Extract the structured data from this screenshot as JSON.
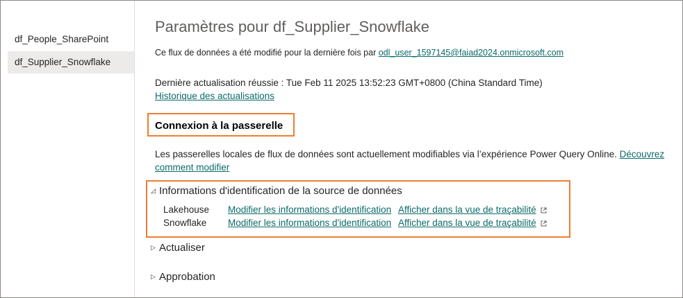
{
  "sidebar": {
    "items": [
      {
        "label": "df_People_SharePoint",
        "selected": false
      },
      {
        "label": "df_Supplier_Snowflake",
        "selected": true
      }
    ]
  },
  "main": {
    "title": "Paramètres pour df_Supplier_Snowflake",
    "modified_prefix": "Ce flux de données a été modifié pour la dernière fois par ",
    "modified_by": "odl_user_1597145@faiad2024.onmicrosoft.com",
    "last_refresh": "Dernière actualisation réussie : Tue Feb 11 2025 13:52:23 GMT+0800 (China Standard Time)",
    "history_link": "Historique des actualisations",
    "gateway": {
      "title": "Connexion à la passerelle",
      "description": "Les passerelles locales de flux de données sont actuellement modifiables via l’expérience Power Query Online. ",
      "learn_link": "Découvrez comment modifier"
    },
    "credentials": {
      "title": "Informations d'identification de la source de données",
      "expanded": true,
      "rows": [
        {
          "name": "Lakehouse",
          "edit": "Modifier les informations d'identification",
          "lineage": "Afficher dans la vue de traçabilité"
        },
        {
          "name": "Snowflake",
          "edit": "Modifier les informations d'identification",
          "lineage": "Afficher dans la vue de traçabilité"
        }
      ]
    },
    "refresh_section": {
      "title": "Actualiser",
      "expanded": false
    },
    "approval_section": {
      "title": "Approbation",
      "expanded": false
    }
  },
  "colors": {
    "highlight": "#ed7d31",
    "link": "#0b6a68",
    "selected_bg": "#edebe9"
  }
}
